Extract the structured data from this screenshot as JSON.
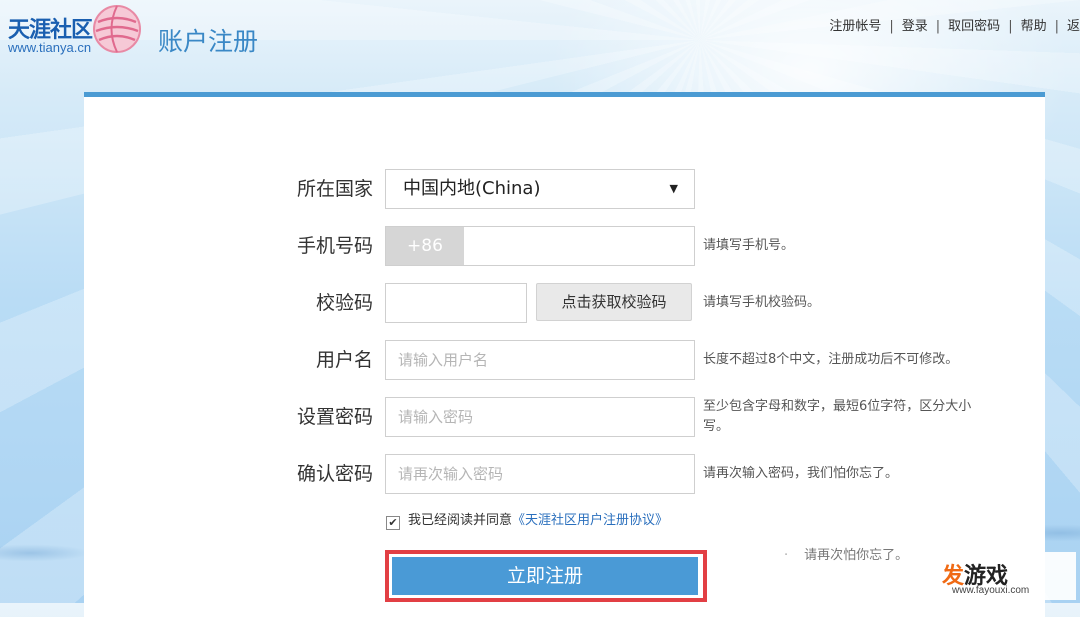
{
  "header": {
    "logo_text": "天涯社区",
    "logo_url": "www.tianya.cn",
    "title": "账户注册",
    "nav": [
      {
        "label": "注册帐号"
      },
      {
        "label": "登录"
      },
      {
        "label": "取回密码"
      },
      {
        "label": "帮助"
      },
      {
        "label": "返"
      }
    ]
  },
  "form": {
    "country": {
      "label": "所在国家",
      "value": "中国内地(China)",
      "arrow": "▼"
    },
    "phone": {
      "label": "手机号码",
      "prefix": "+86",
      "value": "",
      "hint": "请填写手机号。"
    },
    "code": {
      "label": "校验码",
      "value": "",
      "button": "点击获取校验码",
      "hint": "请填写手机校验码。"
    },
    "username": {
      "label": "用户名",
      "placeholder": "请输入用户名",
      "hint": "长度不超过8个中文，注册成功后不可修改。"
    },
    "password": {
      "label": "设置密码",
      "placeholder": "请输入密码",
      "hint": "至少包含字母和数字，最短6位字符，区分大小写。"
    },
    "confirm": {
      "label": "确认密码",
      "placeholder": "请再次输入密码",
      "hint": "请再次输入密码，我们怕你忘了。"
    },
    "agreement": {
      "checked": true,
      "text": "我已经阅读并同意",
      "link": "《天涯社区用户注册协议》"
    },
    "submit": "立即注册",
    "ghost_hint": "请再次怕你忘了。"
  },
  "watermark": {
    "brand_a": "发",
    "brand_b": "游戏",
    "url": "www.fayouxi.com"
  },
  "colors": {
    "accent": "#4a9ad6",
    "highlight_border": "#e23f44",
    "link": "#2a6fbd",
    "brand_orange": "#f06a14"
  }
}
